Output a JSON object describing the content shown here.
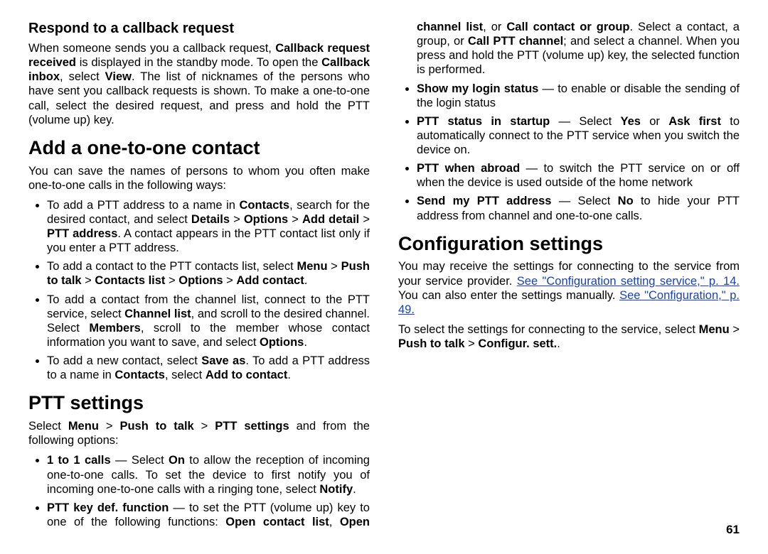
{
  "page_number": "61",
  "left": {
    "respond": {
      "heading": "Respond to a callback request",
      "p1_a": "When someone sends you a callback request, ",
      "p1_b": "Callback request received",
      "p1_c": " is displayed in the standby mode. To open the ",
      "p1_d": "Callback inbox",
      "p1_e": ", select ",
      "p1_f": "View",
      "p1_g": ". The list of nicknames of the persons who have sent you callback requests is shown. To make a one-to-one call, select the desired request, and press and hold the PTT (volume up) key."
    },
    "add": {
      "heading": "Add a one-to-one contact",
      "intro": "You can save the names of persons to whom you often make one-to-one calls in the following ways:",
      "items": {
        "i1_a": "To add a PTT address to a name in ",
        "i1_b": "Contacts",
        "i1_c": ", search for the desired contact, and select ",
        "i1_d": "Details",
        "i1_e": "Options",
        "i1_f": "Add detail",
        "i1_g": "PTT address",
        "i1_h": ". A contact appears in the PTT contact list only if you enter a PTT address.",
        "i2_a": "To add a contact to the PTT contacts list, select ",
        "i2_b": "Menu",
        "i2_c": "Push to talk",
        "i2_d": "Contacts list",
        "i2_e": "Options",
        "i2_f": "Add contact",
        "i3_a": "To add a contact from the channel list, connect to the PTT service, select ",
        "i3_b": "Channel list",
        "i3_c": ", and scroll to the desired channel. Select ",
        "i3_d": "Members",
        "i3_e": ", scroll to the member whose contact information you want to save, and select ",
        "i3_f": "Options",
        "i4_a": "To add a new contact, select ",
        "i4_b": "Save as",
        "i4_c": ". To add a PTT address to a name in ",
        "i4_d": "Contacts",
        "i4_e": ", select ",
        "i4_f": "Add to contact"
      }
    },
    "ptt": {
      "heading": "PTT settings",
      "intro_a": "Select ",
      "intro_b": "Menu",
      "intro_c": "Push to talk",
      "intro_d": "PTT settings",
      "intro_e": " and from the following options:"
    }
  },
  "right": {
    "items": {
      "r1_a": "1 to 1 calls",
      "r1_b": " — Select ",
      "r1_c": "On",
      "r1_d": " to allow the reception of incoming one-to-one calls. To set the device to first notify you of incoming one-to-one calls with a ringing tone, select ",
      "r1_e": "Notify",
      "r2_a": "PTT key def. function",
      "r2_b": " — to set the PTT (volume up) key to one of the following functions: ",
      "r2_c": "Open contact list",
      "r2_d": "Open channel list",
      "r2_e": "Call contact or group",
      "r2_f": ". Select a contact, a group, or ",
      "r2_g": "Call PTT channel",
      "r2_h": "; and select a channel. When you press and hold the PTT (volume up) key, the selected function is performed.",
      "r3_a": "Show my login status",
      "r3_b": " — to enable or disable the sending of the login status",
      "r4_a": "PTT status in startup",
      "r4_b": " — Select ",
      "r4_c": "Yes",
      "r4_d": " or ",
      "r4_e": "Ask first",
      "r4_f": " to automatically connect to the PTT service when you switch the device on.",
      "r5_a": "PTT when abroad",
      "r5_b": " — to switch the PTT service on or off when the device is used outside of the home network",
      "r6_a": "Send my PTT address",
      "r6_b": " — Select ",
      "r6_c": "No",
      "r6_d": " to hide your PTT address from channel and one-to-one calls."
    },
    "config": {
      "heading": "Configuration settings",
      "p1_a": "You may receive the settings for connecting to the service from your service provider. ",
      "p1_link1": "See \"Configuration setting service,\" p. 14.",
      "p1_b": " You can also enter the settings manually. ",
      "p1_link2": "See \"Configuration,\" p. 49.",
      "p2_a": "To select the settings for connecting to the service, select ",
      "p2_b": "Menu",
      "p2_c": "Push to talk",
      "p2_d": "Configur. sett.",
      "p2_e": "."
    }
  },
  "sep": " › ",
  "gt": "  >  ",
  "comma": ", ",
  "or": ", or ",
  "period": "."
}
